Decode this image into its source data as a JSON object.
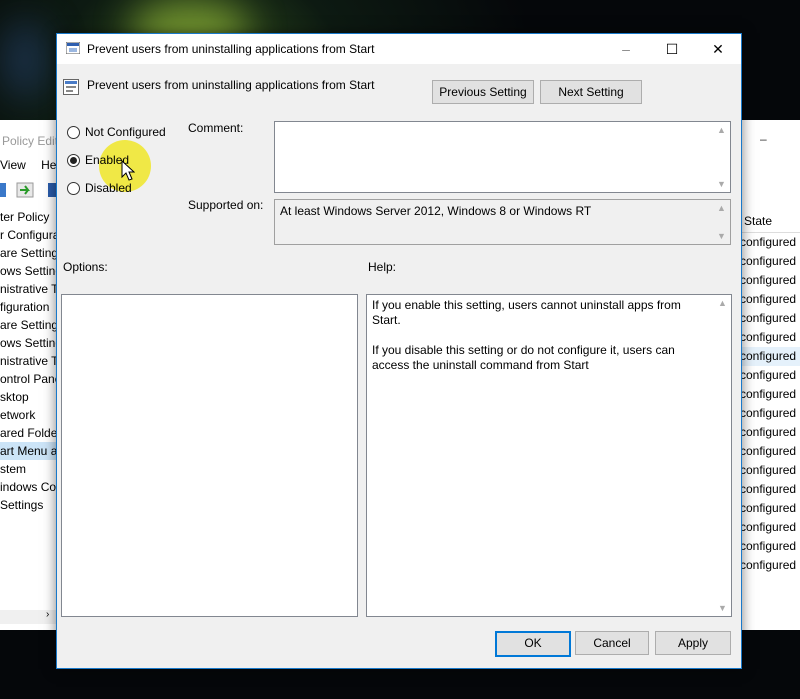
{
  "background_editor": {
    "title_fragment": "Policy Edit",
    "menu": [
      "View",
      "He"
    ],
    "tree_items": [
      "ter Policy",
      "r Configura",
      "are Settings",
      "ows Setting",
      "nistrative Te",
      "figuration",
      "are Settings",
      "ows Setting",
      "nistrative Te",
      "ontrol Pane",
      "sktop",
      "etwork",
      "ared Folde",
      "art Menu an",
      "stem",
      "indows Co",
      "Settings"
    ],
    "selected_tree_index": 13,
    "state_header": "State",
    "state_values": [
      "configured",
      "configured",
      "configured",
      "configured",
      "configured",
      "configured",
      "configured",
      "configured",
      "configured",
      "configured",
      "configured",
      "configured",
      "configured",
      "configured",
      "configured",
      "configured",
      "configured",
      "configured"
    ],
    "highlighted_state_index": 6
  },
  "dialog": {
    "title": "Prevent users from uninstalling applications from Start",
    "header_title": "Prevent users from uninstalling applications from Start",
    "previous_setting": "Previous Setting",
    "next_setting": "Next Setting",
    "radio_not_configured": "Not Configured",
    "radio_enabled": "Enabled",
    "radio_disabled": "Disabled",
    "selected_radio": "Enabled",
    "comment_label": "Comment:",
    "comment_value": "",
    "supported_on_label": "Supported on:",
    "supported_on_value": "At least Windows Server 2012, Windows 8 or Windows RT",
    "options_label": "Options:",
    "help_label": "Help:",
    "help_paragraph_1": "If you enable this setting, users cannot uninstall apps from Start.",
    "help_paragraph_2": "If you disable this setting or do not configure it, users can access the uninstall command from Start",
    "ok": "OK",
    "cancel": "Cancel",
    "apply": "Apply"
  },
  "window_controls": {
    "minimize": "–",
    "maximize": "☐",
    "close": "✕"
  },
  "colors": {
    "accent": "#0078d7",
    "dialog_bg": "#f0f0f0",
    "cursor_highlight": "#f0e628"
  }
}
